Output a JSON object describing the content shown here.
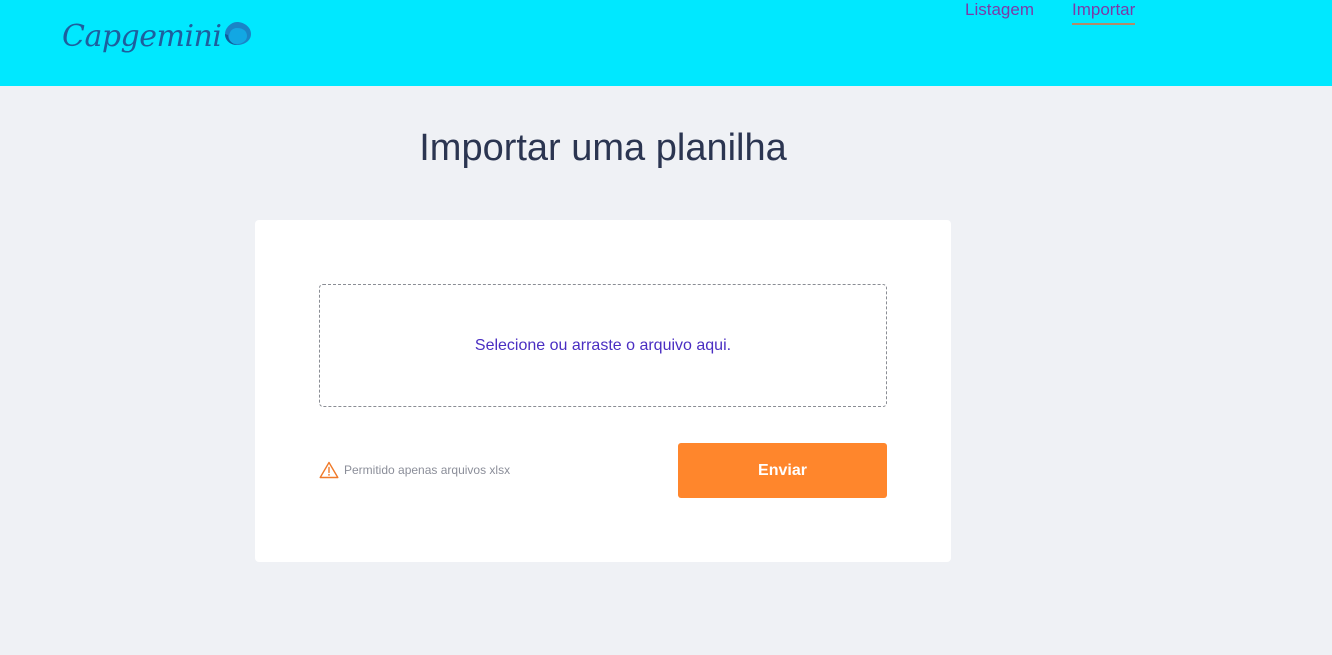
{
  "header": {
    "brand": "Capgemini",
    "brand_color": "#1d5f9e",
    "background": "#00e8ff",
    "nav": [
      {
        "label": "Listagem",
        "active": false
      },
      {
        "label": "Importar",
        "active": true
      }
    ]
  },
  "main": {
    "title": "Importar uma planilha",
    "dropzone_text": "Selecione ou arraste o arquivo aqui.",
    "notice_icon": "warning-triangle-icon",
    "notice_text": "Permitido apenas arquivos xlsx",
    "submit_label": "Enviar",
    "submit_color": "#ff862c"
  }
}
